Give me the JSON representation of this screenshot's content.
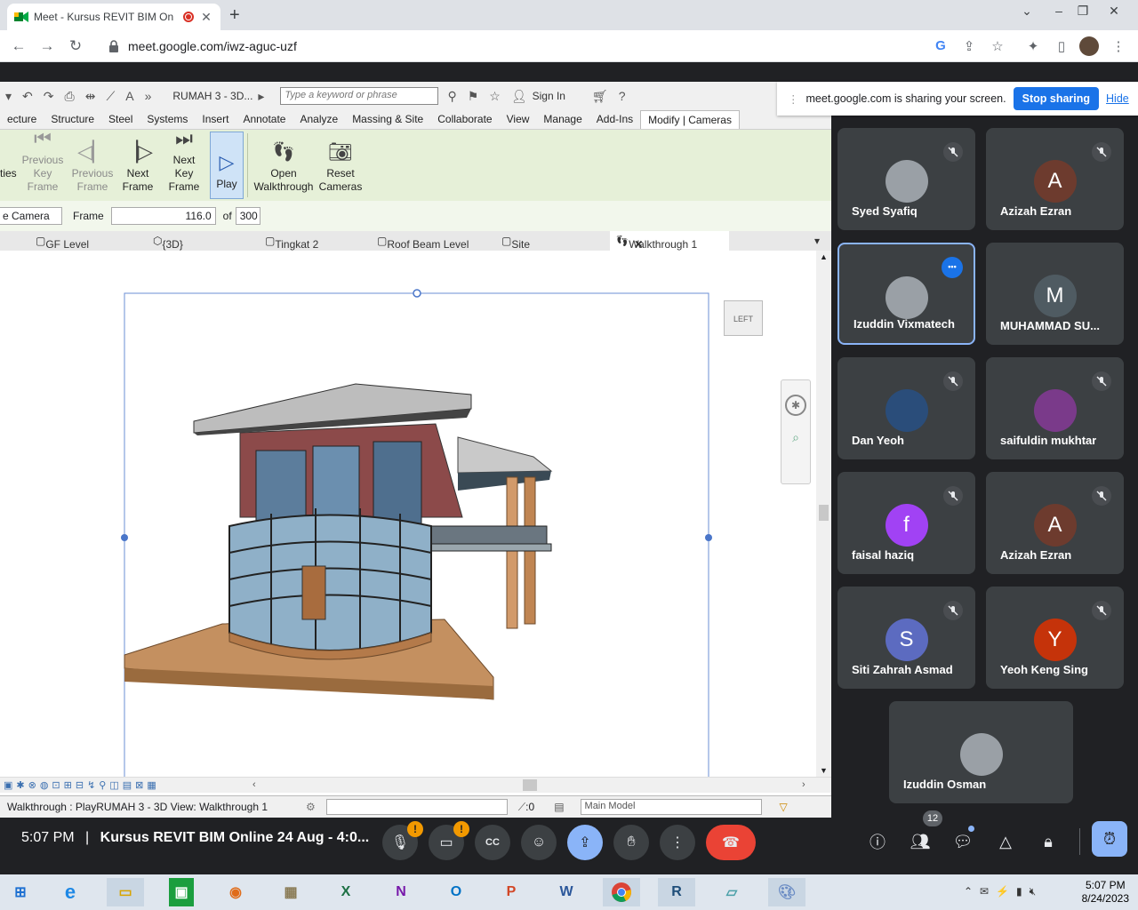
{
  "browser": {
    "tab_title": "Meet - Kursus REVIT BIM On",
    "url": "meet.google.com/iwz-aguc-uzf"
  },
  "revit": {
    "doc_title": "RUMAH 3 - 3D...",
    "search_placeholder": "Type a keyword or phrase",
    "sign_in": "Sign In",
    "menu": [
      "ecture",
      "Structure",
      "Steel",
      "Systems",
      "Insert",
      "Annotate",
      "Analyze",
      "Massing & Site",
      "Collaborate",
      "View",
      "Manage",
      "Add-Ins",
      "Modify | Cameras"
    ],
    "ribbon": {
      "ties": "ties",
      "prev_key": "Previous Key Frame",
      "prev_frame": "Previous Frame",
      "next_frame": "Next Frame",
      "next_key": "Next Key Frame",
      "play": "Play",
      "open_walk": "Open Walkthrough",
      "reset_cam": "Reset Cameras"
    },
    "options": {
      "camera": "e Camera",
      "frame_label": "Frame",
      "frame_value": "116.0",
      "of_label": "of",
      "total": "300"
    },
    "view_tabs": [
      "GF Level",
      "{3D}",
      "Tingkat 2",
      "Roof Beam Level",
      "Site",
      "Walkthrough 1"
    ],
    "viewcube": "LEFT",
    "status_text": "Walkthrough : PlayRUMAH 3 - 3D View: Walkthrough 1",
    "status_zero": ":0",
    "model": "Main Model"
  },
  "share": {
    "message": "meet.google.com is sharing your screen.",
    "stop": "Stop sharing",
    "hide": "Hide"
  },
  "participants": [
    {
      "name": "Syed Syafiq",
      "initial": "",
      "color": "#9aa0a6",
      "muted": true
    },
    {
      "name": "Azizah Ezran",
      "initial": "A",
      "color": "#6d3b2e",
      "muted": true
    },
    {
      "name": "Izuddin Vixmatech",
      "initial": "",
      "color": "#9aa0a6",
      "muted": false
    },
    {
      "name": "MUHAMMAD SU...",
      "initial": "M",
      "color": "#4f5b62",
      "muted": false
    },
    {
      "name": "Dan Yeoh",
      "initial": "",
      "color": "#2a4d7a",
      "muted": true
    },
    {
      "name": "saifuldin mukhtar",
      "initial": "",
      "color": "#7a3a8a",
      "muted": true
    },
    {
      "name": "faisal haziq",
      "initial": "f",
      "color": "#a142f4",
      "muted": true
    },
    {
      "name": "Azizah Ezran",
      "initial": "A",
      "color": "#6d3b2e",
      "muted": true
    },
    {
      "name": "Siti Zahrah Asmad",
      "initial": "S",
      "color": "#5c6bc0",
      "muted": true
    },
    {
      "name": "Yeoh Keng Sing",
      "initial": "Y",
      "color": "#c5330a",
      "muted": true
    },
    {
      "name": "Izuddin Osman",
      "initial": "",
      "color": "#9aa0a6",
      "muted": false
    }
  ],
  "meet": {
    "time": "5:07 PM",
    "separator": "|",
    "meeting_title": "Kursus REVIT BIM Online 24 Aug - 4:0...",
    "people_count": "12"
  },
  "taskbar": {
    "time": "5:07 PM",
    "date": "8/24/2023"
  }
}
